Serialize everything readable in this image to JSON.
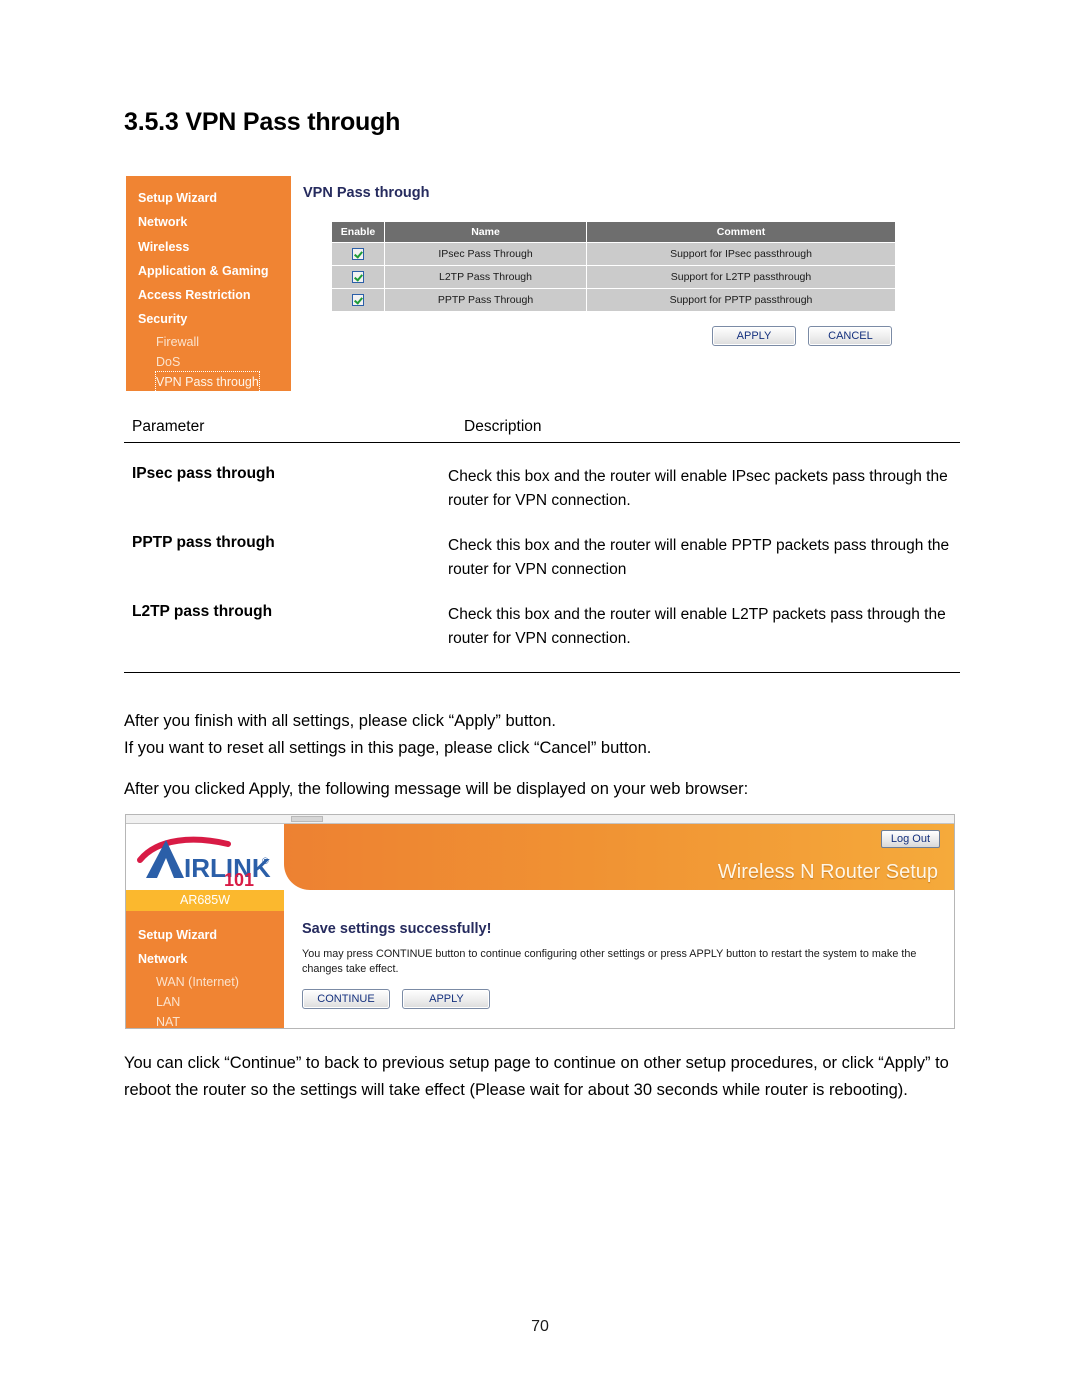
{
  "document": {
    "section_heading": "3.5.3 VPN Pass through",
    "page_number": "70"
  },
  "screenshot_vpn": {
    "sidebar": {
      "top_items": [
        {
          "label": "Setup Wizard"
        },
        {
          "label": "Network"
        },
        {
          "label": "Wireless"
        },
        {
          "label": "Application & Gaming"
        },
        {
          "label": "Access Restriction"
        },
        {
          "label": "Security"
        }
      ],
      "sub_items": [
        {
          "label": "Firewall",
          "selected": false
        },
        {
          "label": "DoS",
          "selected": false
        },
        {
          "label": "VPN Pass through",
          "selected": true
        }
      ]
    },
    "panel_title": "VPN Pass through",
    "table": {
      "headers": [
        "Enable",
        "Name",
        "Comment"
      ],
      "rows": [
        {
          "enabled": true,
          "name": "IPsec Pass Through",
          "comment": "Support for IPsec passthrough"
        },
        {
          "enabled": true,
          "name": "L2TP Pass Through",
          "comment": "Support for L2TP passthrough"
        },
        {
          "enabled": true,
          "name": "PPTP Pass Through",
          "comment": "Support for PPTP passthrough"
        }
      ]
    },
    "buttons": {
      "apply": "APPLY",
      "cancel": "CANCEL"
    }
  },
  "param_table": {
    "header_parameter": "Parameter",
    "header_description": "Description",
    "rows": [
      {
        "parameter": "IPsec pass through",
        "description": "Check this box and the router will enable IPsec packets pass through the router for VPN connection."
      },
      {
        "parameter": "PPTP pass through",
        "description": "Check this box and the router will enable PPTP packets pass through the router for VPN connection"
      },
      {
        "parameter": "L2TP pass through",
        "description": "Check this box and the router will enable L2TP packets pass through the router for VPN connection."
      }
    ]
  },
  "body": {
    "para_1_line_1": "After you finish with all settings, please click “Apply” button.",
    "para_1_line_2": "If you want to reset all settings in this page, please click “Cancel” button.",
    "para_2": "After you clicked Apply, the following message will be displayed on your web browser:",
    "para_3": "You can click “Continue” to back to previous setup page to continue on other setup procedures, or click “Apply” to reboot the router so the settings will take effect (Please wait for about 30 seconds while router is rebooting)."
  },
  "screenshot_save": {
    "brand": {
      "logo_text": "AIRLINK",
      "logo_number": "101",
      "logo_registered": "®",
      "model": "AR685W",
      "banner_title": "Wireless N Router Setup",
      "logout_label": "Log Out"
    },
    "sidebar": {
      "top_items": [
        {
          "label": "Setup Wizard"
        },
        {
          "label": "Network"
        }
      ],
      "sub_items": [
        {
          "label": "WAN (Internet)"
        },
        {
          "label": "LAN"
        },
        {
          "label": "NAT"
        }
      ]
    },
    "message": {
      "title": "Save settings successfully!",
      "text": "You may press CONTINUE button to continue configuring other settings or press APPLY button to restart the system to make the changes take effect."
    },
    "buttons": {
      "continue": "CONTINUE",
      "apply": "APPLY"
    }
  },
  "colors": {
    "sidebar_orange": "#F08433",
    "banner_orange_left": "#ED8132",
    "banner_orange_right": "#F5AA3B",
    "model_badge_yellow": "#FBB82E",
    "panel_title_navy": "#262B5E",
    "table_header_gray": "#6E6E6E",
    "table_cell_gray": "#CBCBCB",
    "logo_blue": "#2B5FA8",
    "logo_red": "#D81B45",
    "checkbox_check_green": "#1E9B38"
  }
}
